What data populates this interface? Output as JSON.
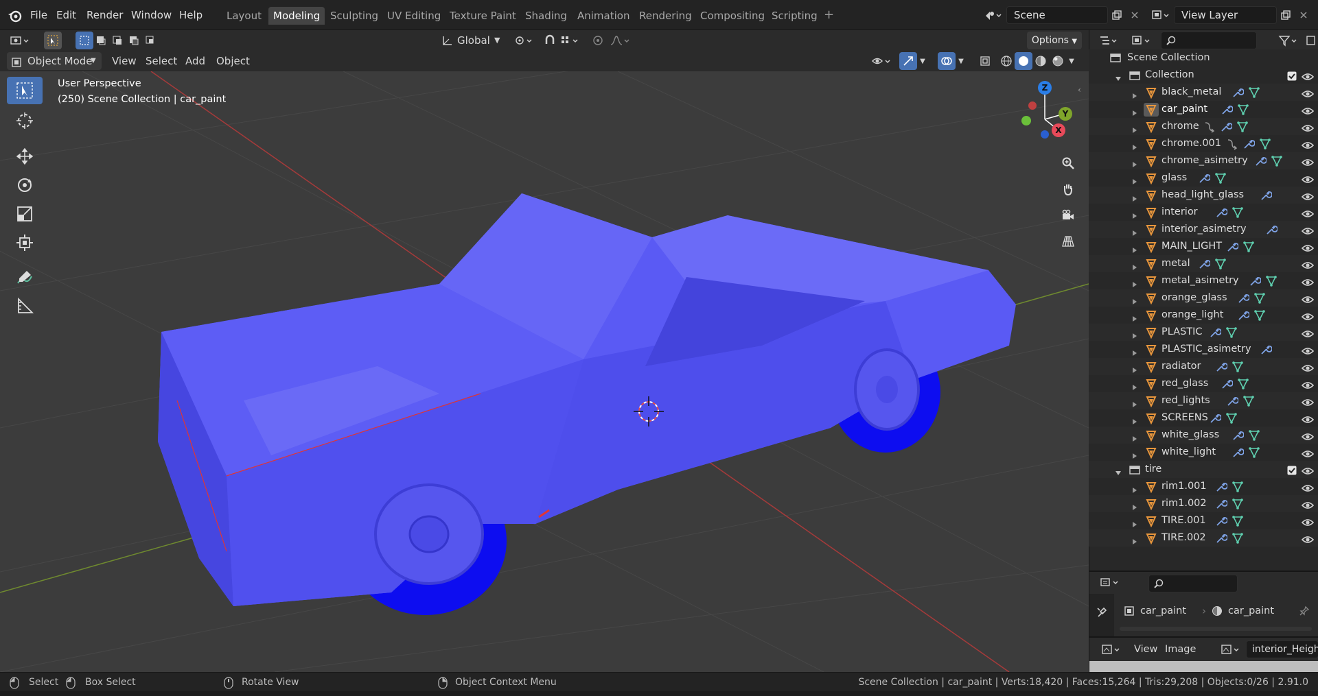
{
  "topbar": {
    "menus": [
      "File",
      "Edit",
      "Render",
      "Window",
      "Help"
    ],
    "workspaces": [
      "Layout",
      "Modeling",
      "Sculpting",
      "UV Editing",
      "Texture Paint",
      "Shading",
      "Animation",
      "Rendering",
      "Compositing",
      "Scripting"
    ],
    "active_workspace": "Modeling",
    "add_tab": "+",
    "scene": "Scene",
    "view_layer": "View Layer"
  },
  "tool_header": {
    "orientation": "Global",
    "options": "Options"
  },
  "viewport_header": {
    "mode": "Object Mode",
    "menus": [
      "View",
      "Select",
      "Add",
      "Object"
    ]
  },
  "viewport": {
    "perspective": "User Perspective",
    "context": "(250) Scene Collection | car_paint",
    "gizmo": {
      "x": "X",
      "y": "Y",
      "z": "Z"
    },
    "car_color": "#5555f2"
  },
  "outliner": {
    "search_placeholder": "",
    "scene_collection": "Scene Collection",
    "rows": [
      {
        "name": "Collection",
        "type": "collection"
      },
      {
        "name": "black_metal",
        "type": "object"
      },
      {
        "name": "car_paint",
        "type": "object",
        "active": true
      },
      {
        "name": "chrome",
        "type": "object"
      },
      {
        "name": "chrome.001",
        "type": "object"
      },
      {
        "name": "chrome_asimetry",
        "type": "object"
      },
      {
        "name": "glass",
        "type": "object"
      },
      {
        "name": "head_light_glass",
        "type": "object"
      },
      {
        "name": "interior",
        "type": "object"
      },
      {
        "name": "interior_asimetry",
        "type": "object"
      },
      {
        "name": "MAIN_LIGHT",
        "type": "object"
      },
      {
        "name": "metal",
        "type": "object"
      },
      {
        "name": "metal_asimetry",
        "type": "object"
      },
      {
        "name": "orange_glass",
        "type": "object"
      },
      {
        "name": "orange_light",
        "type": "object"
      },
      {
        "name": "PLASTIC",
        "type": "object"
      },
      {
        "name": "PLASTIC_asimetry",
        "type": "object"
      },
      {
        "name": "radiator",
        "type": "object"
      },
      {
        "name": "red_glass",
        "type": "object"
      },
      {
        "name": "red_lights",
        "type": "object"
      },
      {
        "name": "SCREENS",
        "type": "object"
      },
      {
        "name": "white_glass",
        "type": "object"
      },
      {
        "name": "white_light",
        "type": "object"
      },
      {
        "name": "tire",
        "type": "collection"
      },
      {
        "name": "rim1.001",
        "type": "object"
      },
      {
        "name": "rim1.002",
        "type": "object"
      },
      {
        "name": "TIRE.001",
        "type": "object"
      },
      {
        "name": "TIRE.002",
        "type": "object"
      }
    ]
  },
  "properties": {
    "object": "car_paint",
    "data": "car_paint"
  },
  "image_editor": {
    "menus": [
      "View",
      "Image"
    ],
    "image": "interior_Height.p"
  },
  "statusbar": {
    "select": "Select",
    "box_select": "Box Select",
    "rotate": "Rotate View",
    "context_menu": "Object Context Menu",
    "stats": "Scene Collection | car_paint | Verts:18,420 | Faces:15,264 | Tris:29,208 | Objects:0/26 | 2.91.0"
  },
  "colors": {
    "accent": "#4772b3",
    "object_icon": "#e8963c",
    "collection_icon": "#c8c8c8",
    "modifier_icon": "#7fa3e6",
    "mesh_icon": "#5fd0b0"
  }
}
